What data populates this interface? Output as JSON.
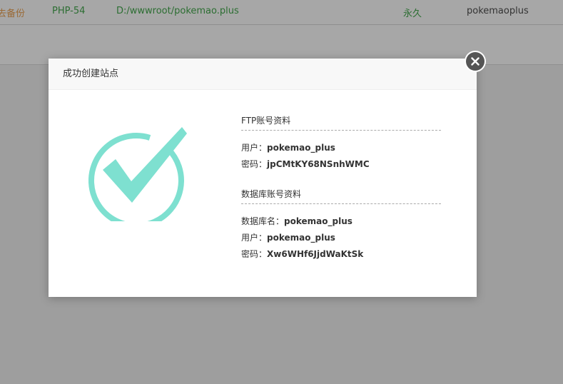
{
  "background": {
    "row": {
      "backup": "去备份",
      "php": "PHP-54",
      "path": "D:/wwwroot/pokemao.plus",
      "expire": "永久",
      "note": "pokemaoplus"
    }
  },
  "modal": {
    "title": "成功创建站点",
    "close_icon": "close-icon",
    "success_icon": "check-circle-icon",
    "accent_color": "#7ee0d0",
    "ftp": {
      "heading": "FTP账号资料",
      "user_label": "用户：",
      "user_value": "pokemao_plus",
      "pass_label": "密码：",
      "pass_value": "jpCMtKY68NSnhWMC"
    },
    "db": {
      "heading": "数据库账号资料",
      "name_label": "数据库名：",
      "name_value": "pokemao_plus",
      "user_label": "用户：",
      "user_value": "pokemao_plus",
      "pass_label": "密码：",
      "pass_value": "Xw6WHf6JjdWaKtSk"
    }
  }
}
